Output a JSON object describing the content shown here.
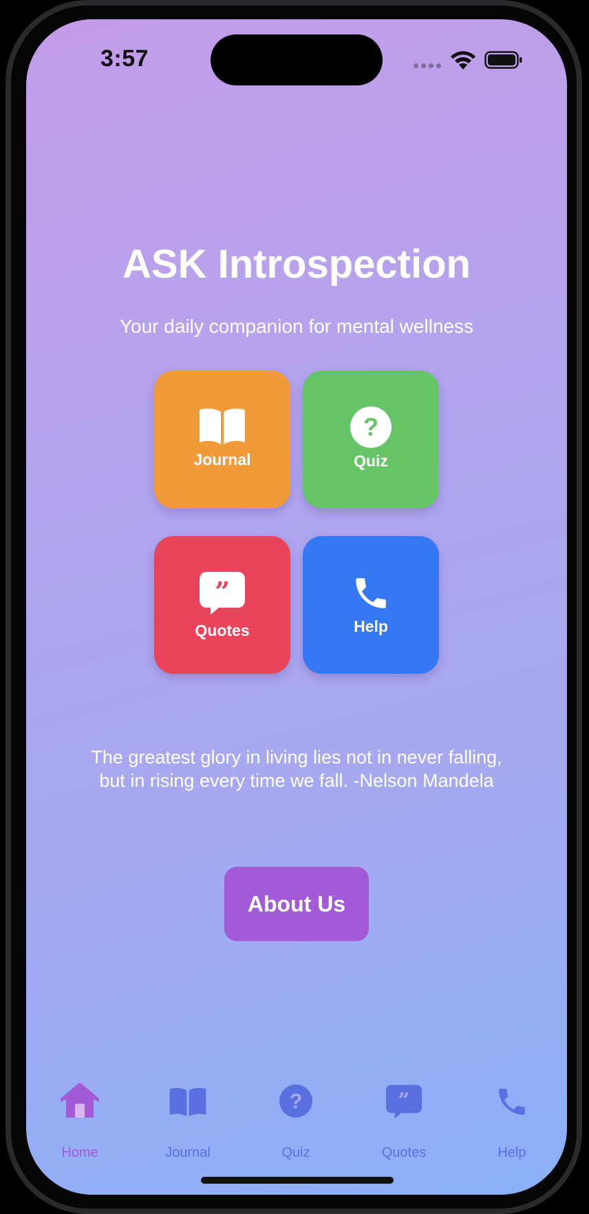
{
  "status_bar": {
    "time": "3:57"
  },
  "header": {
    "title": "ASK Introspection",
    "subtitle": "Your daily companion for mental wellness"
  },
  "tiles": [
    {
      "label": "Journal",
      "icon": "book-icon",
      "color": "#f09a3a"
    },
    {
      "label": "Quiz",
      "icon": "question-circle-icon",
      "color": "#65c466"
    },
    {
      "label": "Quotes",
      "icon": "quote-bubble-icon",
      "color": "#e9445a"
    },
    {
      "label": "Help",
      "icon": "phone-icon",
      "color": "#3478f6"
    }
  ],
  "quote": {
    "line1": "The greatest glory in living lies not in never falling,",
    "line2": "but in rising every time we fall. -Nelson Mandela"
  },
  "about_button": {
    "label": "About Us",
    "color": "#a25ad6"
  },
  "tab_bar": {
    "active_color": "#a25ad6",
    "inactive_color": "#5a6fe0",
    "items": [
      {
        "label": "Home",
        "icon": "house-icon",
        "active": true
      },
      {
        "label": "Journal",
        "icon": "book-icon",
        "active": false
      },
      {
        "label": "Quiz",
        "icon": "question-circle-icon",
        "active": false
      },
      {
        "label": "Quotes",
        "icon": "quote-bubble-icon",
        "active": false
      },
      {
        "label": "Help",
        "icon": "phone-icon",
        "active": false
      }
    ]
  }
}
